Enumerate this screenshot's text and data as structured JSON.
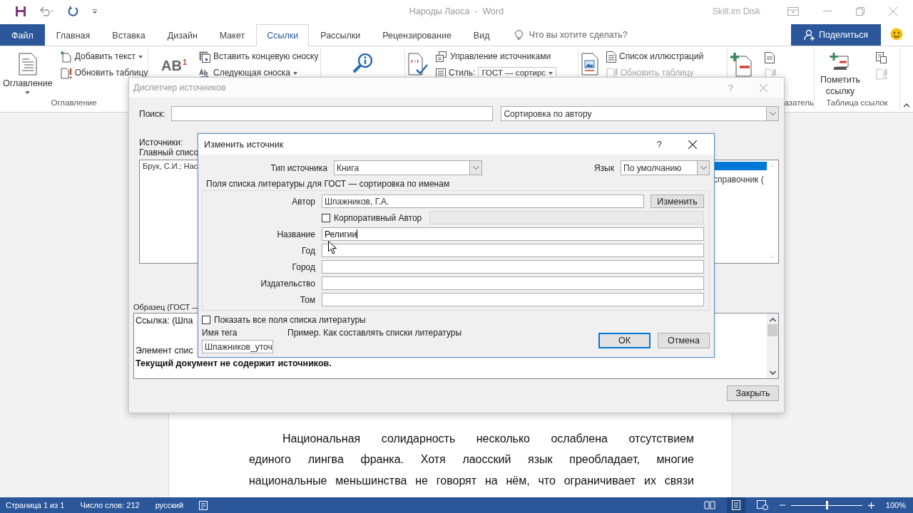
{
  "title_bar": {
    "document_title": "Народы Лаоса  -  Word",
    "account": "Skill.im Disk"
  },
  "tabs": [
    {
      "label": "Файл",
      "kind": "file",
      "selected": false
    },
    {
      "label": "Главная",
      "kind": "tab",
      "selected": false
    },
    {
      "label": "Вставка",
      "kind": "tab",
      "selected": false
    },
    {
      "label": "Дизайн",
      "kind": "tab",
      "selected": false
    },
    {
      "label": "Макет",
      "kind": "tab",
      "selected": false
    },
    {
      "label": "Ссылки",
      "kind": "tab",
      "selected": true
    },
    {
      "label": "Рассылки",
      "kind": "tab",
      "selected": false
    },
    {
      "label": "Рецензирование",
      "kind": "tab",
      "selected": false
    },
    {
      "label": "Вид",
      "kind": "tab",
      "selected": false
    }
  ],
  "tell_me": {
    "placeholder": "Что вы хотите сделать?"
  },
  "share_button": "Поделиться",
  "ribbon": {
    "toc": {
      "big_label": "Оглавление",
      "add_text": "Добавить текст",
      "update_table": "Обновить таблицу",
      "group_label": "Оглавление"
    },
    "footnotes": {
      "icon_text": "AB",
      "icon_mark": "1",
      "insert_endnote": "Вставить концевую сноску",
      "next_footnote": "Следующая сноска"
    },
    "citations": {
      "manage_sources": "Управление источниками",
      "style_label": "Стиль:",
      "style_value": "ГОСТ — сортирс"
    },
    "captions": {
      "table_of_figures": "Список иллюстраций",
      "update_table": {
        "label": "Обновить таблицу",
        "disabled": true
      }
    },
    "index": {
      "group_label": "азатель"
    },
    "authorities": {
      "mark_citation": "Пометить ссылку",
      "group_label": "Таблица ссылок"
    }
  },
  "source_manager": {
    "title": "Диспетчер источников",
    "help": "?",
    "search_label": "Поиск:",
    "sort_value": "Сортировка по автору",
    "sources_label": "Источники:",
    "master_list_label": "Главный списо",
    "master_list": [
      {
        "text": "Брук, С.И.; Нас"
      }
    ],
    "current_list": [
      {
        "selected": true
      },
      {
        "text": "справочник (",
        "selected": false
      }
    ],
    "preview_label": "Образец (ГОСТ —",
    "preview_citation": "Ссылка:  (Шпа",
    "preview_item": "Элемент спис",
    "preview_note": "Текущий документ не содержит источников.",
    "close_button": "Закрыть"
  },
  "edit_source": {
    "title": "Изменить источник",
    "help": "?",
    "type_label": "Тип источника",
    "type_value": "Книга",
    "language_label": "Язык",
    "language_value": "По умолчанию",
    "group_label": "Поля списка литературы для ГОСТ — сортировка по именам",
    "author": {
      "label": "Автор",
      "value": "Шпажников, Г.А.",
      "button": "Изменить"
    },
    "corporate_author": {
      "label": "Корпоративный Автор",
      "checked": false
    },
    "fields": [
      {
        "label": "Название",
        "value": "Религии",
        "focused": true
      },
      {
        "label": "Год",
        "focused": false
      },
      {
        "label": "Город",
        "focused": false
      },
      {
        "label": "Издательство",
        "focused": false
      },
      {
        "label": "Том",
        "focused": false
      }
    ],
    "show_all": {
      "label": "Показать все поля списка литературы",
      "checked": false
    },
    "tag_label": "Имя тега",
    "tag_value": "Шпажников_уточ",
    "example_link": "Пример. Как составлять списки литературы",
    "ok_button": "ОК",
    "cancel_button": "Отмена"
  },
  "document": {
    "lines": [
      "Национальная солидарность несколько ослаблена отсутствием",
      "единого лингва франка. Хотя лаосский язык преобладает, многие",
      "национальные меньшинства не говорят на нём, что ограничивает их связи"
    ]
  },
  "status_bar": {
    "page": "Страница 1 из 1",
    "words": "Число слов: 212",
    "language": "русский",
    "zoom": {
      "level": 0.5,
      "reading": "100%"
    }
  }
}
